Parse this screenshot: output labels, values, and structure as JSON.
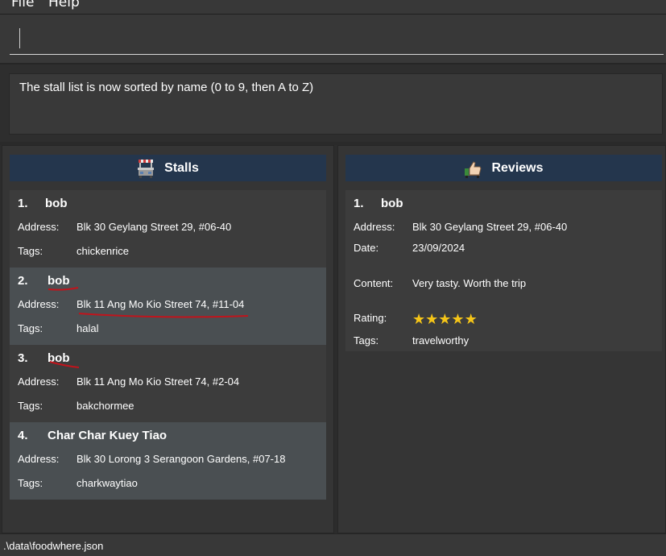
{
  "menu": {
    "file": "File",
    "help": "Help"
  },
  "command": {
    "value": "",
    "placeholder": ""
  },
  "result": {
    "message": "The stall list is now sorted by name (0 to 9, then A to Z)"
  },
  "stalls": {
    "title": "Stalls",
    "icon": "food-stall-icon",
    "labels": {
      "address": "Address:",
      "tags": "Tags:"
    },
    "items": [
      {
        "index": "1.",
        "name": "bob",
        "address": "Blk 30 Geylang Street 29, #06-40",
        "tags": "chickenrice"
      },
      {
        "index": "2.",
        "name": "bob",
        "address": "Blk 11 Ang Mo Kio Street 74, #11-04",
        "tags": "halal"
      },
      {
        "index": "3.",
        "name": "bob",
        "address": "Blk 11 Ang Mo Kio Street 74, #2-04",
        "tags": "bakchormee"
      },
      {
        "index": "4.",
        "name": "Char Char Kuey Tiao",
        "address": "Blk 30 Lorong 3 Serangoon Gardens, #07-18",
        "tags": "charkwaytiao"
      }
    ]
  },
  "reviews": {
    "title": "Reviews",
    "icon": "thumbs-up-icon",
    "labels": {
      "address": "Address:",
      "date": "Date:",
      "content": "Content:",
      "rating": "Rating:",
      "tags": "Tags:"
    },
    "items": [
      {
        "index": "1.",
        "name": "bob",
        "address": "Blk 30 Geylang Street 29, #06-40",
        "date": "23/09/2024",
        "content": "Very tasty. Worth the trip",
        "rating": 5,
        "tags": "travelworthy"
      }
    ]
  },
  "status": {
    "path": ".\\data\\foodwhere.json"
  },
  "colors": {
    "header": "#24364d",
    "card_odd": "#3c3c3c",
    "card_even": "#4a4f52",
    "star": "#f5c518",
    "annotation": "#c0141c"
  }
}
